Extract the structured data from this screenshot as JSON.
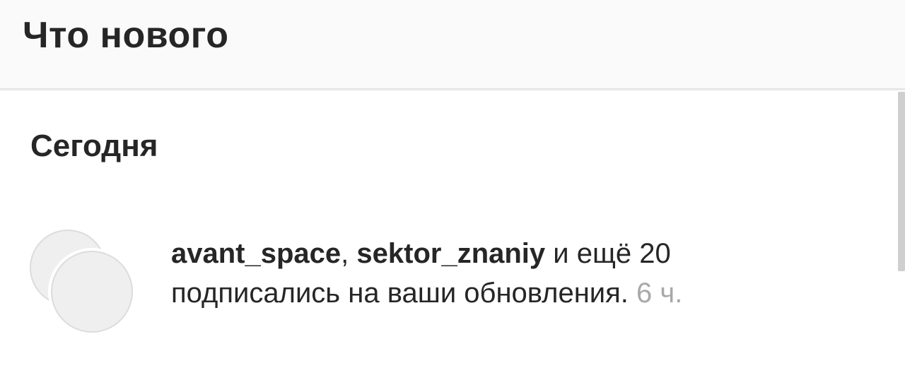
{
  "header": {
    "title": "Что нового"
  },
  "section": {
    "heading": "Сегодня"
  },
  "notification": {
    "user1": "avant_space",
    "separator": ", ",
    "user2": "sektor_znaniy",
    "and_more": " и ещё 20",
    "message": "подписались на ваши обновления.",
    "time": "6 ч."
  },
  "colors": {
    "header_bg": "#fafafa",
    "text": "#262626",
    "muted": "#a8a8a8",
    "avatar_fill": "#efefef"
  }
}
